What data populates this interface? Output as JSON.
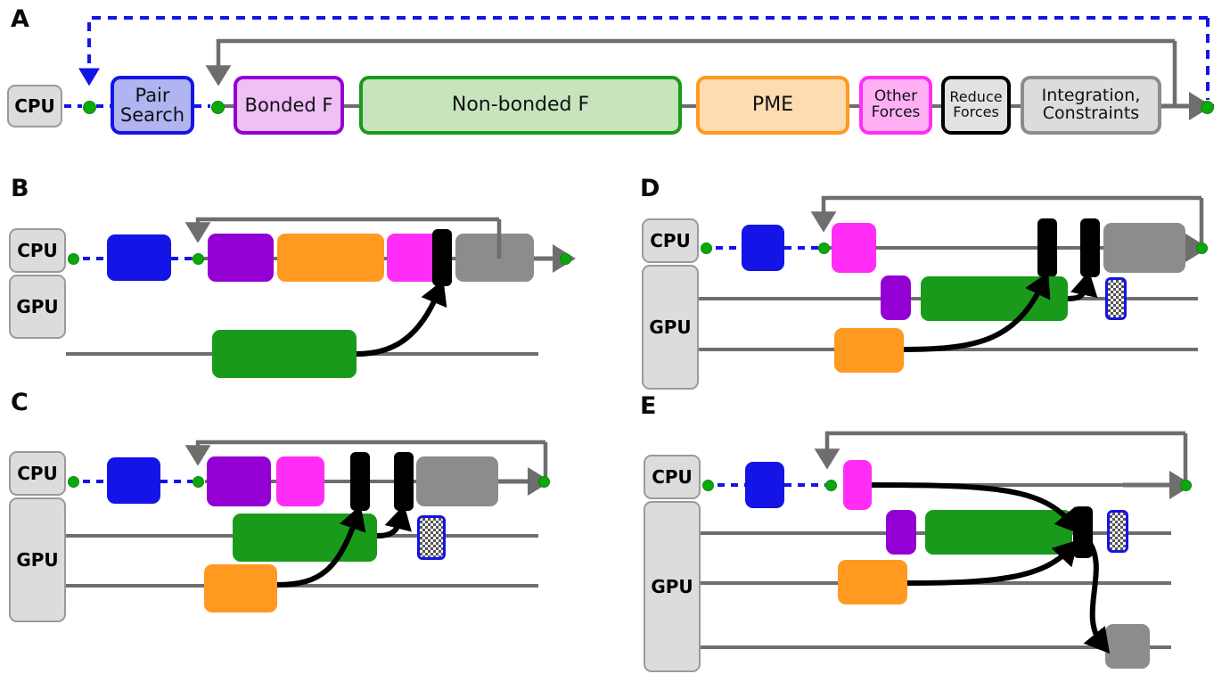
{
  "figure": {
    "panels": [
      "A",
      "B",
      "C",
      "D",
      "E"
    ],
    "hardware_labels": {
      "cpu": "CPU",
      "gpu": "GPU"
    }
  },
  "panelA": {
    "letter": "A",
    "cpu_label": "CPU",
    "tasks": [
      {
        "name": "pair-search",
        "label": "Pair\nSearch",
        "text": "Pair Search",
        "fill": "#b0b4f0",
        "stroke": "#1414e6"
      },
      {
        "name": "bonded",
        "label": "Bonded F",
        "text": "Bonded F",
        "fill": "#efbff5",
        "stroke": "#9400d3"
      },
      {
        "name": "nonbonded",
        "label": "Non-bonded F",
        "text": "Non-bonded F",
        "fill": "#c6e5bd",
        "stroke": "#1a9a1a"
      },
      {
        "name": "pme",
        "label": "PME",
        "text": "PME",
        "fill": "#fcdcb0",
        "stroke": "#ff9920"
      },
      {
        "name": "other-forces",
        "label": "Other\nForces",
        "text": "Other Forces",
        "fill": "#ffb0f5",
        "stroke": "#ff2df5"
      },
      {
        "name": "reduce-forces",
        "label": "Reduce\nForces",
        "text": "Reduce Forces",
        "fill": "#e2e2e2",
        "stroke": "#000000"
      },
      {
        "name": "integration",
        "label": "Integration,\nConstraints",
        "text": "Integration, Constraints",
        "fill": "#dcdcdc",
        "stroke": "#8c8c8c"
      }
    ]
  },
  "panelB": {
    "letter": "B",
    "cpu_label": "CPU",
    "gpu_label": "GPU",
    "cpu_tasks": [
      {
        "name": "pair-search",
        "color": "#1414e6"
      },
      {
        "name": "bonded",
        "color": "#9400d3"
      },
      {
        "name": "pme",
        "color": "#ff9920"
      },
      {
        "name": "other-forces",
        "color": "#ff2df5"
      },
      {
        "name": "integration",
        "color": "#8c8c8c"
      }
    ],
    "sync_bars": 1,
    "gpu_tasks": [
      {
        "name": "nonbonded",
        "color": "#1a9a1a",
        "track": 0
      }
    ],
    "gpu_track_count": 1
  },
  "panelC": {
    "letter": "C",
    "cpu_label": "CPU",
    "gpu_label": "GPU",
    "cpu_tasks": [
      {
        "name": "pair-search",
        "color": "#1414e6"
      },
      {
        "name": "bonded",
        "color": "#9400d3"
      },
      {
        "name": "other-forces",
        "color": "#ff2df5"
      },
      {
        "name": "integration",
        "color": "#8c8c8c"
      }
    ],
    "sync_bars": 2,
    "gpu_tasks": [
      {
        "name": "nonbonded",
        "color": "#1a9a1a",
        "track": 0
      },
      {
        "name": "pme",
        "color": "#ff9920",
        "track": 1
      }
    ],
    "transfer_box": {
      "name": "pme-transfer",
      "stroke": "#1414e6",
      "track": 0
    },
    "gpu_track_count": 2
  },
  "panelD": {
    "letter": "D",
    "cpu_label": "CPU",
    "gpu_label": "GPU",
    "cpu_tasks": [
      {
        "name": "pair-search",
        "color": "#1414e6"
      },
      {
        "name": "other-forces",
        "color": "#ff2df5"
      },
      {
        "name": "integration",
        "color": "#8c8c8c"
      }
    ],
    "sync_bars": 2,
    "gpu_tasks": [
      {
        "name": "bonded",
        "color": "#9400d3",
        "track": 0
      },
      {
        "name": "nonbonded",
        "color": "#1a9a1a",
        "track": 0
      },
      {
        "name": "pme",
        "color": "#ff9920",
        "track": 1
      }
    ],
    "transfer_box": {
      "name": "pme-transfer",
      "stroke": "#1414e6",
      "track": 0
    },
    "gpu_track_count": 2
  },
  "panelE": {
    "letter": "E",
    "cpu_label": "CPU",
    "gpu_label": "GPU",
    "cpu_tasks": [
      {
        "name": "pair-search",
        "color": "#1414e6"
      },
      {
        "name": "other-forces",
        "color": "#ff2df5"
      }
    ],
    "sync_bars": 1,
    "gpu_tasks": [
      {
        "name": "bonded",
        "color": "#9400d3",
        "track": 0
      },
      {
        "name": "nonbonded",
        "color": "#1a9a1a",
        "track": 0
      },
      {
        "name": "pme",
        "color": "#ff9920",
        "track": 1
      },
      {
        "name": "integration",
        "color": "#8c8c8c",
        "track": 2
      }
    ],
    "transfer_box": {
      "name": "pme-transfer",
      "stroke": "#1414e6",
      "track": 0
    },
    "gpu_track_count": 3
  },
  "colors": {
    "loop_arrow": "#6e6e6e",
    "step_dashed": "#1414e6",
    "sync_point": "#0ba80b",
    "sync_bar": "#000000",
    "track": "#6e6e6e"
  }
}
